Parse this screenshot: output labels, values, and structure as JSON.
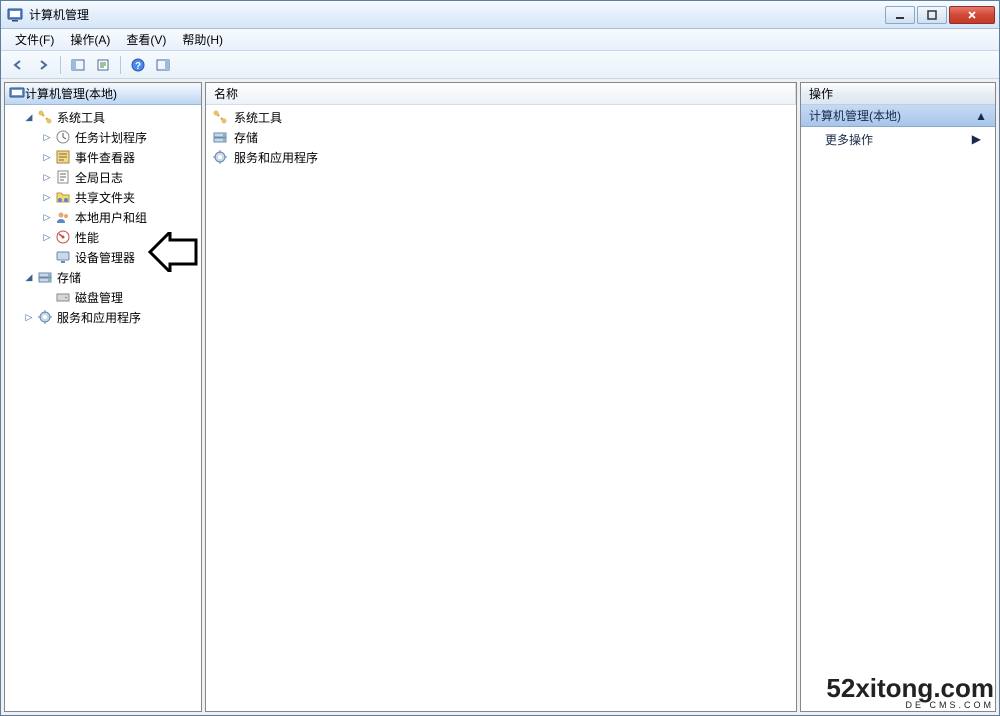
{
  "window": {
    "title": "计算机管理"
  },
  "menu": {
    "file": "文件(F)",
    "action": "操作(A)",
    "view": "查看(V)",
    "help": "帮助(H)"
  },
  "tree": {
    "root": "计算机管理(本地)",
    "system_tools": "系统工具",
    "task_scheduler": "任务计划程序",
    "event_viewer": "事件查看器",
    "global_log": "全局日志",
    "shared_folders": "共享文件夹",
    "local_users": "本地用户和组",
    "performance": "性能",
    "device_manager": "设备管理器",
    "storage": "存储",
    "disk_mgmt": "磁盘管理",
    "services_apps": "服务和应用程序"
  },
  "list": {
    "column_name": "名称",
    "items": {
      "system_tools": "系统工具",
      "storage": "存储",
      "services_apps": "服务和应用程序"
    }
  },
  "actions": {
    "header": "操作",
    "section": "计算机管理(本地)",
    "more": "更多操作"
  },
  "watermark": {
    "main": "52xitong.com",
    "sub": "DE CMS.COM"
  }
}
